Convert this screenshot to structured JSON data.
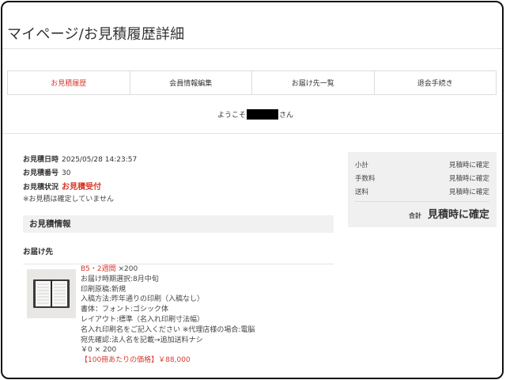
{
  "page": {
    "title": "マイページ/お見積履歴詳細"
  },
  "tabs": [
    {
      "label": "お見積履歴",
      "active": true
    },
    {
      "label": "会員情報編集",
      "active": false
    },
    {
      "label": "お届け先一覧",
      "active": false
    },
    {
      "label": "退会手続き",
      "active": false
    }
  ],
  "welcome": {
    "prefix": "ようこそ",
    "suffix": "さん"
  },
  "meta": {
    "date_label": "お見積日時",
    "date_value": "2025/05/28 14:23:57",
    "number_label": "お見積番号",
    "number_value": "30",
    "status_label": "お見積状況",
    "status_value": "お見積受付",
    "note": "※お見積は確定していません"
  },
  "section": {
    "title": "お見積情報",
    "destination_label": "お届け先"
  },
  "item": {
    "name": "B5・2週間",
    "qty": "×200",
    "lines": [
      "お届け時期選択:8月中旬",
      "印刷原稿:新規",
      "入稿方法:昨年通りの印刷（入稿なし）",
      "書体：フォント:ゴシック体",
      "レイアウト:標準（名入れ印刷寸法幅）",
      "名入れ印刷名をご記入ください ※代理店様の場合:電脳",
      "宛先確認:法人名を記載→追加送料ナシ",
      "￥0 × 200"
    ],
    "price_note": "【100冊あたりの価格】￥88,000"
  },
  "summary": {
    "rows": [
      {
        "label": "小計",
        "value": "見積時に確定"
      },
      {
        "label": "手数料",
        "value": "見積時に確定"
      },
      {
        "label": "送料",
        "value": "見積時に確定"
      }
    ],
    "total_label": "合計",
    "total_value": "見積時に確定"
  },
  "colors": {
    "accent": "#d9392b",
    "panel": "#f0f0f0"
  }
}
